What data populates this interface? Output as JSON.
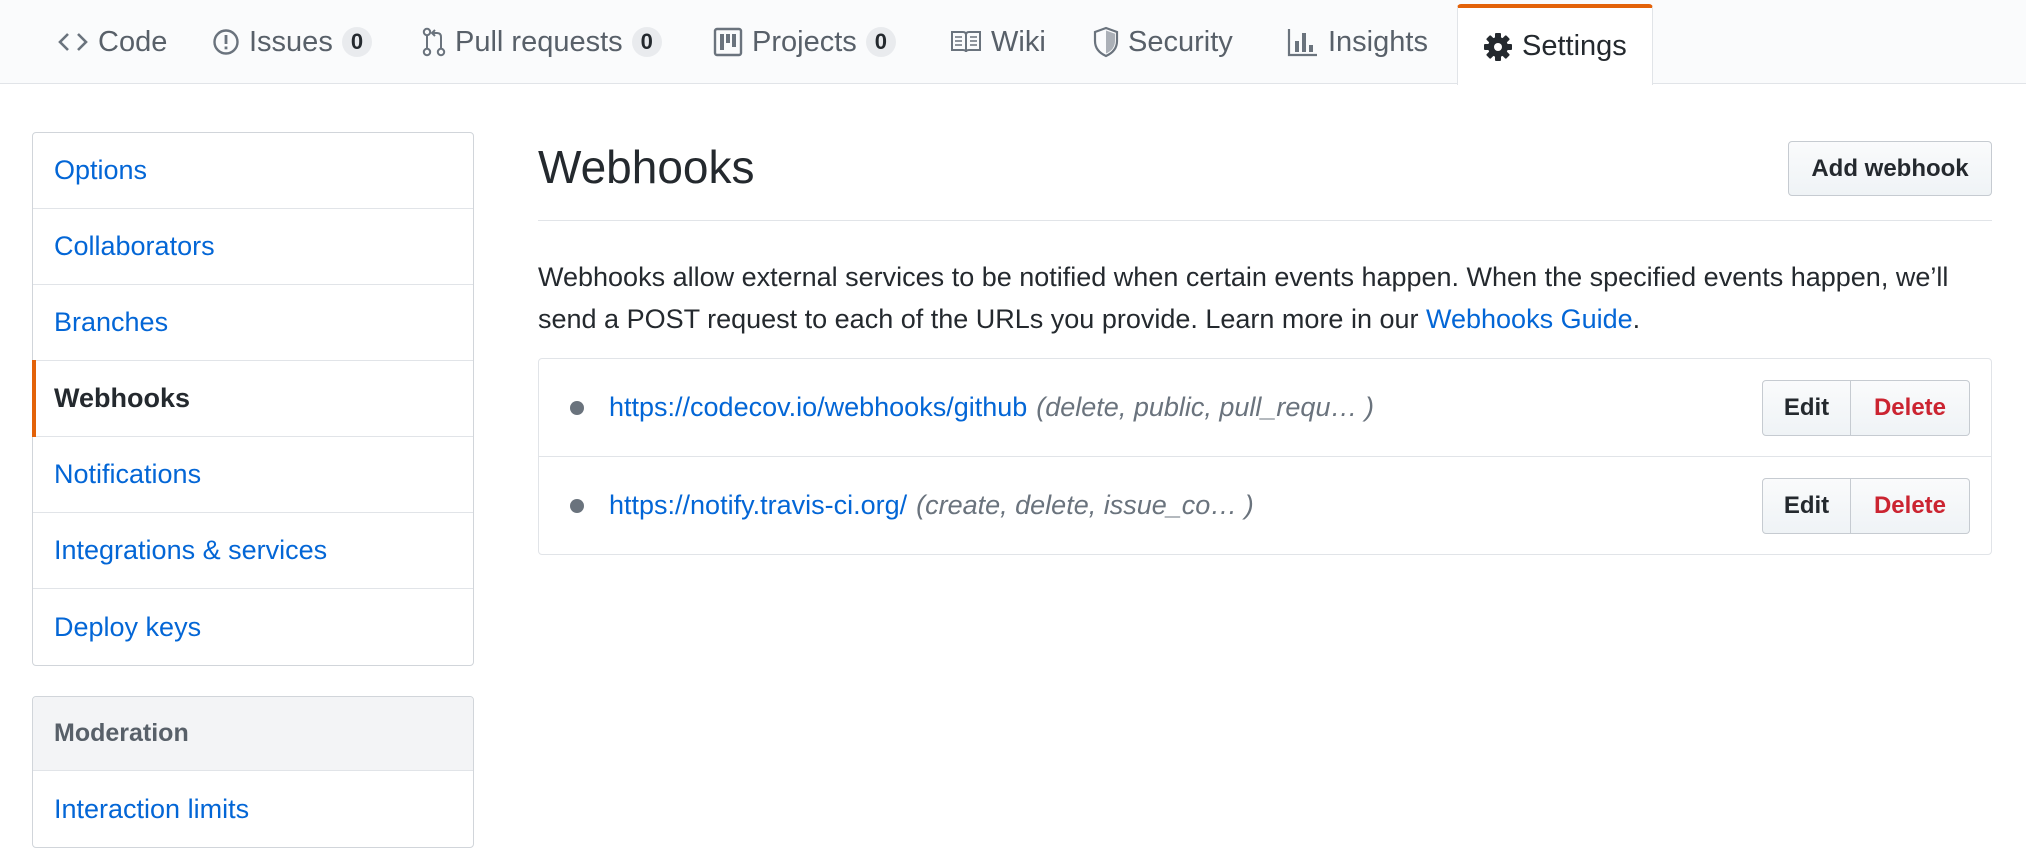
{
  "repo_nav": {
    "tabs": [
      {
        "label": "Code",
        "icon": "code-icon"
      },
      {
        "label": "Issues",
        "icon": "issue-opened-icon",
        "count": "0"
      },
      {
        "label": "Pull requests",
        "icon": "git-pull-request-icon",
        "count": "0"
      },
      {
        "label": "Projects",
        "icon": "project-icon",
        "count": "0"
      },
      {
        "label": "Wiki",
        "icon": "book-icon"
      },
      {
        "label": "Security",
        "icon": "shield-icon"
      },
      {
        "label": "Insights",
        "icon": "graph-icon"
      },
      {
        "label": "Settings",
        "icon": "gear-icon",
        "selected": true
      }
    ]
  },
  "sidebar": {
    "items": [
      {
        "label": "Options"
      },
      {
        "label": "Collaborators"
      },
      {
        "label": "Branches"
      },
      {
        "label": "Webhooks",
        "active": true
      },
      {
        "label": "Notifications"
      },
      {
        "label": "Integrations & services"
      },
      {
        "label": "Deploy keys"
      }
    ],
    "moderation": {
      "heading": "Moderation",
      "items": [
        {
          "label": "Interaction limits"
        }
      ]
    }
  },
  "main": {
    "title": "Webhooks",
    "add_button_label": "Add webhook",
    "description_text": "Webhooks allow external services to be notified when certain events happen. When the specified events happen, we’ll send a POST request to each of the URLs you provide. Learn more in our ",
    "guide_link_label": "Webhooks Guide",
    "description_end": ".",
    "webhooks": [
      {
        "url": "https://codecov.io/webhooks/github",
        "events": "(delete, public, pull_requ…  )",
        "edit_label": "Edit",
        "delete_label": "Delete"
      },
      {
        "url": "https://notify.travis-ci.org/",
        "events": "(create, delete, issue_co…  )",
        "edit_label": "Edit",
        "delete_label": "Delete"
      }
    ]
  },
  "colors": {
    "accent": "#e36209",
    "link": "#0366d6",
    "danger": "#cb2431",
    "muted": "#6a737d"
  }
}
